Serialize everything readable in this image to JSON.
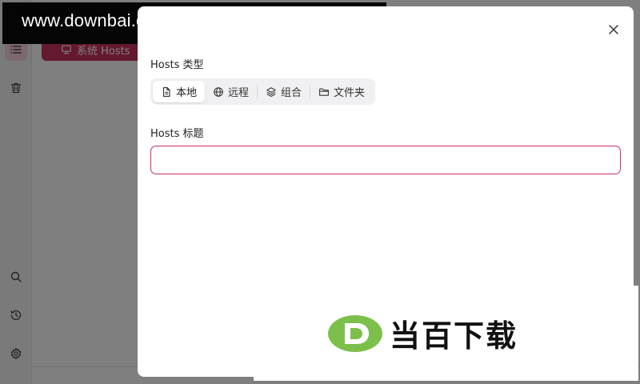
{
  "watermark_top": {
    "text": "www.downbai.com"
  },
  "sidebar": {
    "icons": [
      "list-icon",
      "trash-icon",
      "search-icon",
      "history-icon",
      "gear-icon"
    ]
  },
  "background": {
    "system_hosts_label": "系统 Hosts"
  },
  "modal": {
    "hosts_type_label": "Hosts 类型",
    "type_options": [
      {
        "label": "本地",
        "icon": "file-icon",
        "selected": true
      },
      {
        "label": "远程",
        "icon": "globe-icon",
        "selected": false
      },
      {
        "label": "组合",
        "icon": "layers-icon",
        "selected": false
      },
      {
        "label": "文件夹",
        "icon": "folder-icon",
        "selected": false
      }
    ],
    "hosts_title_label": "Hosts 标题",
    "hosts_title_value": "",
    "close_icon": "close-icon"
  },
  "watermark_bottom": {
    "text": "当百下载"
  },
  "colors": {
    "accent": "#c4355e",
    "active_bg": "#f6d3dc"
  }
}
